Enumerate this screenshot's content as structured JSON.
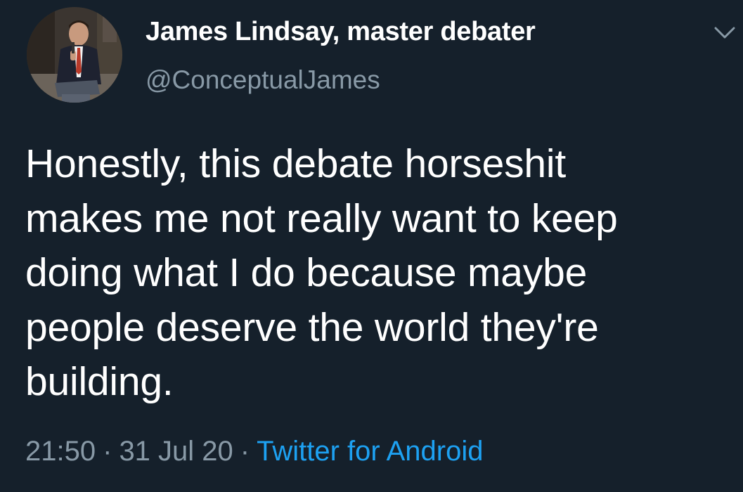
{
  "tweet": {
    "author": {
      "display_name": "James Lindsay, master debater",
      "handle": "@ConceptualJames"
    },
    "text_lines": [
      "Honestly, this debate horseshit",
      "makes me not really want to keep",
      "doing what I do because maybe",
      "people deserve the world they're",
      "building."
    ],
    "time": "21:50",
    "date": "31 Jul 20",
    "separator": "·",
    "source": "Twitter for Android",
    "menu_icon": "chevron-down-icon"
  },
  "colors": {
    "background": "#15202b",
    "primary_text": "#ffffff",
    "secondary_text": "#8899a6",
    "link": "#1da1f2"
  }
}
